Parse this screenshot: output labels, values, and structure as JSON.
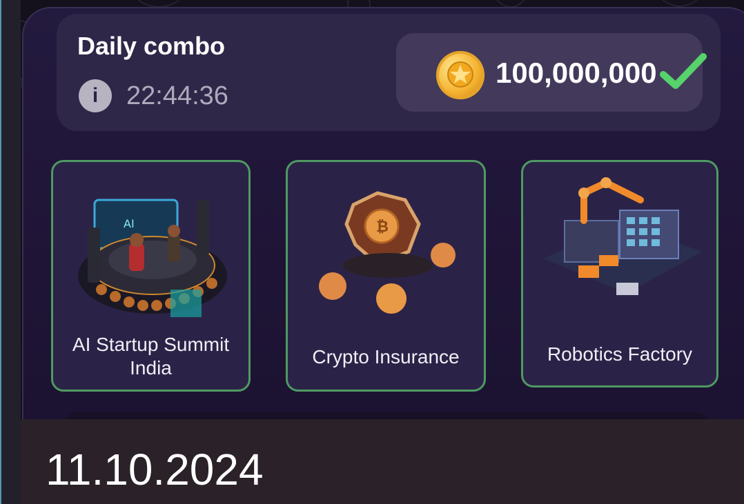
{
  "combo": {
    "title": "Daily combo",
    "timer": "22:44:36",
    "reward": "100,000,000"
  },
  "cards": [
    {
      "label_line1": "AI Startup Summit",
      "label_line2": "India"
    },
    {
      "label_line1": "Crypto Insurance"
    },
    {
      "label_line1": "Robotics Factory"
    }
  ],
  "footer": {
    "date": "11.10.2024"
  },
  "colors": {
    "accent_green": "#4f9a62",
    "check_green": "#56d36b",
    "coin_gold": "#f5b331"
  },
  "icons": {
    "info": "info-icon",
    "coin": "coin-icon",
    "check": "check-icon"
  }
}
